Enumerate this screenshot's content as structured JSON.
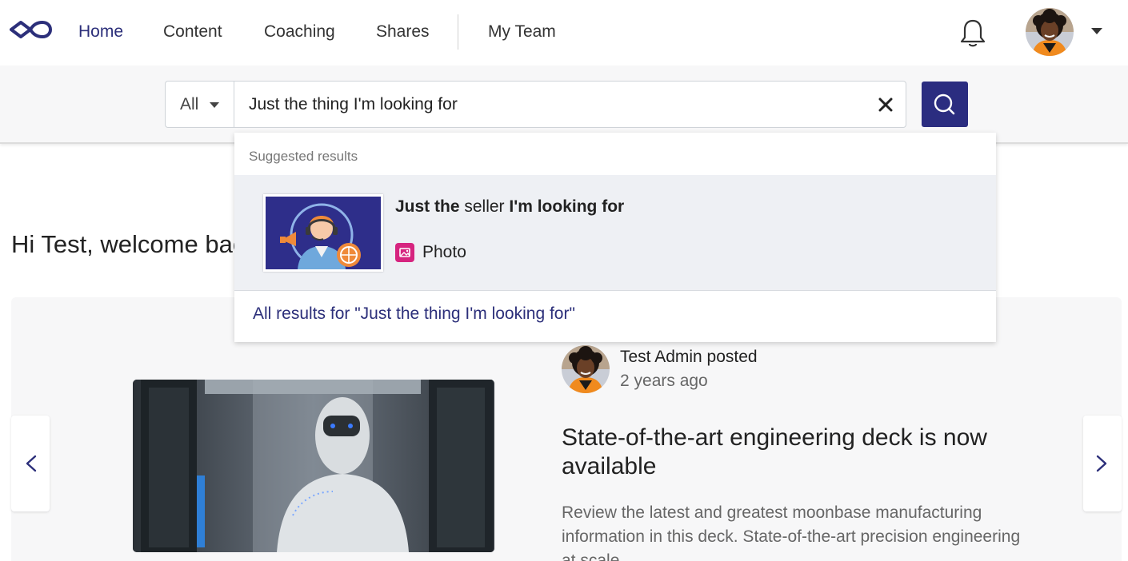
{
  "nav": {
    "logo_icon": "infinity-logo-icon",
    "items": [
      {
        "label": "Home",
        "active": true
      },
      {
        "label": "Content",
        "active": false
      },
      {
        "label": "Coaching",
        "active": false
      },
      {
        "label": "Shares",
        "active": false
      },
      {
        "label": "My Team",
        "active": false
      }
    ],
    "bell_icon": "bell-icon",
    "avatar_icon": "user-avatar",
    "menu_caret_icon": "caret-down-icon"
  },
  "search": {
    "scope_label": "All",
    "query": "Just the thing I'm looking for",
    "clear_icon": "close-icon",
    "submit_icon": "search-icon",
    "accent_color": "#2b2d80"
  },
  "suggestions": {
    "header": "Suggested results",
    "results": [
      {
        "title_bold_1": "Just the",
        "title_normal": " seller ",
        "title_bold_2": "I'm looking for",
        "type_label": "Photo",
        "type_icon": "photo-icon",
        "type_color": "#d6247f"
      }
    ],
    "all_results_link": "All results for \"Just the thing I'm looking for\""
  },
  "welcome": {
    "text": "Hi Test, welcome bac"
  },
  "feed": {
    "prev_icon": "chevron-left-icon",
    "next_icon": "chevron-right-icon",
    "post": {
      "author": "Test Admin posted",
      "time": "2 years ago",
      "title": "State-of-the-art engineering deck is now available",
      "description": "Review the latest and greatest moonbase manufacturing information in this deck. State-of-the-art precision engineering at scale."
    }
  }
}
